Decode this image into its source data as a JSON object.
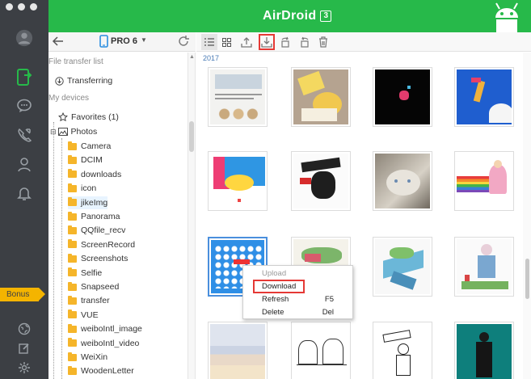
{
  "app": {
    "title": "AirDroid",
    "version": "3"
  },
  "rail": {
    "items": [
      "avatar",
      "file-transfer",
      "messages",
      "calls",
      "contacts",
      "notifications"
    ],
    "bonus_label": "Bonus"
  },
  "device": {
    "name": "PRO 6"
  },
  "sidebar": {
    "file_transfer_label": "File transfer list",
    "transferring_label": "Transferring",
    "my_devices_label": "My devices",
    "favorites_label": "Favorites (1)",
    "photos_label": "Photos",
    "folders": [
      "Camera",
      "DCIM",
      "downloads",
      "icon",
      "jikeImg",
      "Panorama",
      "QQfile_recv",
      "ScreenRecord",
      "Screenshots",
      "Selfie",
      "Snapseed",
      "transfer",
      "VUE",
      "weiboIntl_image",
      "weiboIntl_video",
      "WeiXin",
      "WoodenLetter"
    ],
    "selected_folder": "jikeImg"
  },
  "toolbar": {
    "buttons": [
      "list-view",
      "grid-view",
      "upload",
      "download",
      "rotate-left",
      "rotate-right",
      "delete"
    ],
    "highlighted": "download"
  },
  "content": {
    "year_label": "2017"
  },
  "context_menu": {
    "items": [
      {
        "label": "Upload",
        "shortcut": "",
        "disabled": true
      },
      {
        "label": "Download",
        "shortcut": "",
        "disabled": false
      },
      {
        "label": "Refresh",
        "shortcut": "F5",
        "disabled": false
      },
      {
        "label": "Delete",
        "shortcut": "Del",
        "disabled": false
      }
    ]
  },
  "colors": {
    "brand_green": "#27b94a",
    "rail_dark": "#3c3f44",
    "highlight_red": "#e53935",
    "folder_yellow": "#f5b52a",
    "bonus_yellow": "#f4b400"
  }
}
